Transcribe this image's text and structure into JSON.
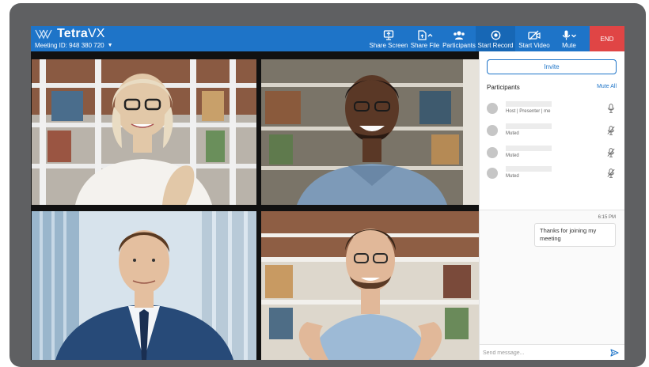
{
  "app": {
    "brand_bold": "Tetra",
    "brand_light": "VX",
    "meeting_id": "Meeting ID: 948 380 720",
    "meeting_caret": "▼"
  },
  "toolbar": {
    "share_screen": "Share Screen",
    "share_file": "Share File",
    "participants": "Participants",
    "start_record": "Start Record",
    "start_video": "Start Video",
    "mute": "Mute",
    "end": "END"
  },
  "panel": {
    "invite": "Invite",
    "participants_title": "Participants",
    "mute_all": "Mute All",
    "participants": [
      {
        "status": "Host | Presenter | me",
        "mic": "mic-icon"
      },
      {
        "status": "Muted",
        "mic": "mic-muted-icon"
      },
      {
        "status": "Muted",
        "mic": "mic-muted-icon"
      },
      {
        "status": "Muted",
        "mic": "mic-muted-icon"
      }
    ]
  },
  "chat": {
    "messages": [
      {
        "time": "6:15 PM",
        "text": "Thanks for joining my meeting"
      }
    ],
    "placeholder": "Send message..."
  },
  "colors": {
    "accent": "#1e74c8",
    "end": "#e04545",
    "frame": "#5f6062"
  }
}
